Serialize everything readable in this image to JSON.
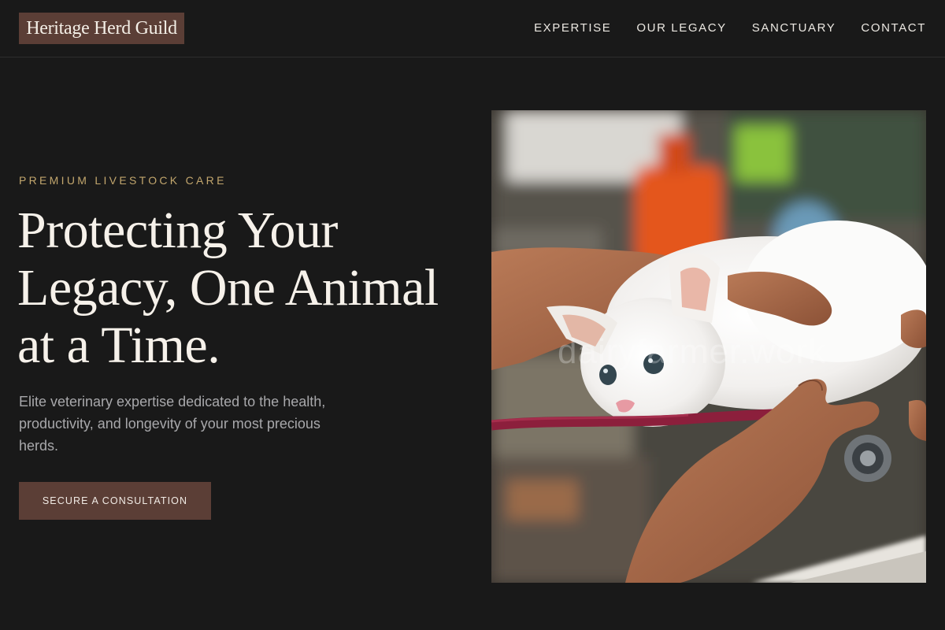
{
  "brand": {
    "name": "Heritage Herd Guild"
  },
  "nav": {
    "items": [
      {
        "label": "EXPERTISE"
      },
      {
        "label": "OUR LEGACY"
      },
      {
        "label": "SANCTUARY"
      },
      {
        "label": "CONTACT"
      }
    ]
  },
  "hero": {
    "eyebrow": "PREMIUM LIVESTOCK CARE",
    "headline": "Protecting Your Legacy, One Animal at a Time.",
    "description": "Elite veterinary expertise dedicated to the health, productivity, and longevity of your most precious herds.",
    "cta_label": "SECURE A CONSULTATION",
    "image": {
      "subject": "white kitten being examined by hands with a stethoscope",
      "watermark": "dairyfarmer.work"
    }
  },
  "colors": {
    "background": "#191919",
    "accent_brown": "#5b3e36",
    "eyebrow_gold": "#c2a66d",
    "headline": "#f6f1ea",
    "body_text": "#a8a8ab"
  }
}
